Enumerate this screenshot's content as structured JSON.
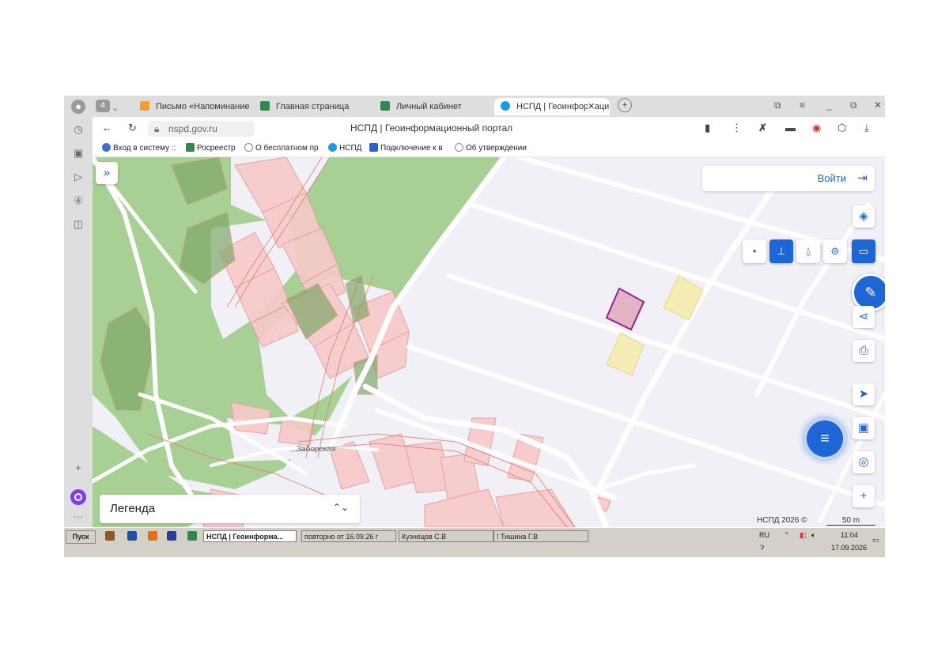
{
  "browser": {
    "tab_count": "4",
    "tabs": [
      {
        "label": "Письмо «Напоминание о",
        "icon": "mail-icon",
        "color": "#f0a030"
      },
      {
        "label": "Главная страница",
        "icon": "rosreestr-icon",
        "color": "#2d8a4e"
      },
      {
        "label": "Личный кабинет",
        "icon": "rosreestr-icon",
        "color": "#2d8a4e"
      },
      {
        "label": "НСПД | Геоинформаци",
        "icon": "nspd-icon",
        "color": "#1e9be0"
      }
    ],
    "url": "nspd.gov.ru",
    "page_title": "НСПД | Геоинформационный портал",
    "bookmarks": [
      {
        "label": "Вход в систему ::",
        "color": "#3b6fd6"
      },
      {
        "label": "Росреестр",
        "color": "#2d8a4e"
      },
      {
        "label": "О бесплатном пр",
        "color": "#888888"
      },
      {
        "label": "НСПД",
        "color": "#1e9be0"
      },
      {
        "label": "Подключение к в",
        "color": "#2a5fd6"
      },
      {
        "label": "Об утверждении",
        "color": "#888888"
      }
    ]
  },
  "map": {
    "login_label": "Войти",
    "legend_label": "Легенда",
    "street_label": "Заборская",
    "copyright": "НСПД 2026 ©",
    "scale_label": "50 m",
    "accent": "#1e66d6"
  },
  "taskbar": {
    "start_label": "Пуск",
    "windows": [
      {
        "label": "НСПД | Геоинформа...",
        "active": true
      },
      {
        "label": "повторно от 16.09.26 г",
        "active": false
      },
      {
        "label": "Кузнецов С.В",
        "active": false
      },
      {
        "label": "! Тишина Г.В",
        "active": false
      }
    ],
    "lang": "RU",
    "time": "11:04",
    "date": "17.09.2026"
  }
}
